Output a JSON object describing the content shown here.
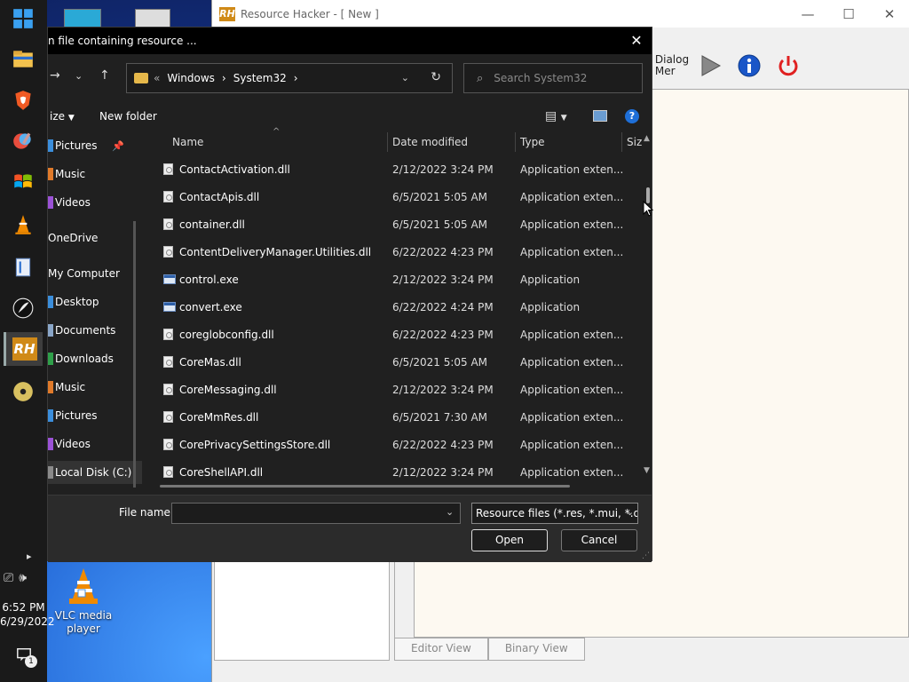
{
  "desktop": {
    "vlc_label": "VLC media player"
  },
  "taskbar": {
    "clock_time": "6:52 PM",
    "clock_date": "6/29/2022",
    "notification_count": "1",
    "active_app": "RH"
  },
  "resource_hacker": {
    "title": "Resource Hacker - [ New ]",
    "dialog_merge_label": "Dialog\nMer",
    "tabs": [
      "Editor View",
      "Binary View"
    ],
    "colors": {
      "accent_power": "#e02020",
      "info": "#1a56c8"
    }
  },
  "dialog": {
    "title": "n file containing resource ...",
    "address": {
      "crumbs": [
        "Windows",
        "System32"
      ]
    },
    "search_placeholder": "Search System32",
    "organize_label": "ize",
    "new_folder_label": "New folder",
    "nav_items": [
      {
        "label": "Pictures",
        "pinned": true
      },
      {
        "label": "Music"
      },
      {
        "label": "Videos"
      },
      {
        "label": "OneDrive"
      },
      {
        "label": "My Computer"
      },
      {
        "label": "Desktop"
      },
      {
        "label": "Documents"
      },
      {
        "label": "Downloads"
      },
      {
        "label": "Music"
      },
      {
        "label": "Pictures"
      },
      {
        "label": "Videos"
      },
      {
        "label": "Local Disk (C:)"
      }
    ],
    "columns": {
      "name": "Name",
      "date": "Date modified",
      "type": "Type",
      "size": "Siz"
    },
    "files": [
      {
        "name": "ContactActivation.dll",
        "date": "2/12/2022 3:24 PM",
        "type": "Application exten...",
        "kind": "dll"
      },
      {
        "name": "ContactApis.dll",
        "date": "6/5/2021 5:05 AM",
        "type": "Application exten...",
        "kind": "dll"
      },
      {
        "name": "container.dll",
        "date": "6/5/2021 5:05 AM",
        "type": "Application exten...",
        "kind": "dll"
      },
      {
        "name": "ContentDeliveryManager.Utilities.dll",
        "date": "6/22/2022 4:23 PM",
        "type": "Application exten...",
        "kind": "dll"
      },
      {
        "name": "control.exe",
        "date": "2/12/2022 3:24 PM",
        "type": "Application",
        "kind": "exe"
      },
      {
        "name": "convert.exe",
        "date": "6/22/2022 4:24 PM",
        "type": "Application",
        "kind": "exe"
      },
      {
        "name": "coreglobconfig.dll",
        "date": "6/22/2022 4:23 PM",
        "type": "Application exten...",
        "kind": "dll"
      },
      {
        "name": "CoreMas.dll",
        "date": "6/5/2021 5:05 AM",
        "type": "Application exten...",
        "kind": "dll"
      },
      {
        "name": "CoreMessaging.dll",
        "date": "2/12/2022 3:24 PM",
        "type": "Application exten...",
        "kind": "dll"
      },
      {
        "name": "CoreMmRes.dll",
        "date": "6/5/2021 7:30 AM",
        "type": "Application exten...",
        "kind": "dll"
      },
      {
        "name": "CorePrivacySettingsStore.dll",
        "date": "6/22/2022 4:23 PM",
        "type": "Application exten...",
        "kind": "dll"
      },
      {
        "name": "CoreShellAPI.dll",
        "date": "2/12/2022 3:24 PM",
        "type": "Application exten...",
        "kind": "dll"
      }
    ],
    "file_name_label": "File name:",
    "file_name_value": "",
    "filter_value": "Resource files (*.res, *.mui, *.dll",
    "open_label": "Open",
    "cancel_label": "Cancel"
  }
}
